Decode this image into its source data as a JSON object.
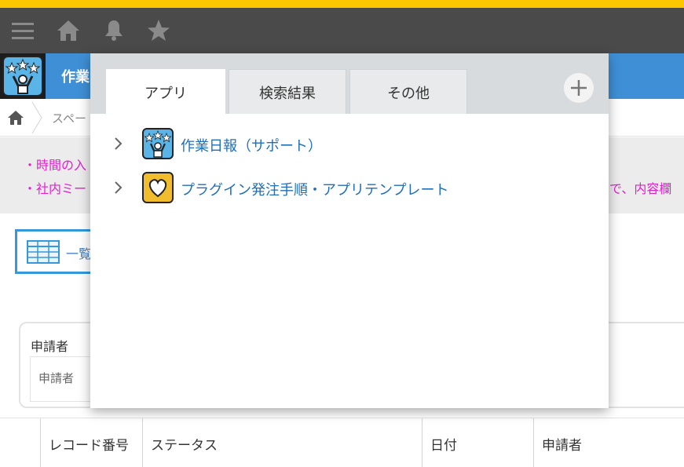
{
  "colors": {
    "accent_top": "#fdc700",
    "topbar": "#4a4a4a",
    "app_header": "#3f8fd6",
    "notice_text": "#e31fd0",
    "link": "#1f6fb8"
  },
  "topbar": {
    "icons": [
      "menu-icon",
      "home-icon",
      "bell-icon",
      "star-icon"
    ]
  },
  "app": {
    "title": "作業"
  },
  "breadcrumb": {
    "space": "スペー"
  },
  "notice": {
    "line1": "・時間の入",
    "line2": "・社内ミー",
    "line2_tail": "で、内容欄"
  },
  "view_button": {
    "label": "一覧"
  },
  "filter": {
    "label": "申請者",
    "placeholder": "申請者"
  },
  "table": {
    "columns": [
      "レコード番号",
      "ステータス",
      "日付",
      "申請者"
    ]
  },
  "popup": {
    "tabs": [
      {
        "label": "アプリ",
        "active": true
      },
      {
        "label": "検索結果",
        "active": false
      },
      {
        "label": "その他",
        "active": false
      }
    ],
    "add_icon": "plus-icon",
    "items": [
      {
        "title": "作業日報（サポート）",
        "icon": "support-app-icon"
      },
      {
        "title": "プラグイン発注手順・アプリテンプレート",
        "icon": "heart-app-icon"
      }
    ]
  }
}
